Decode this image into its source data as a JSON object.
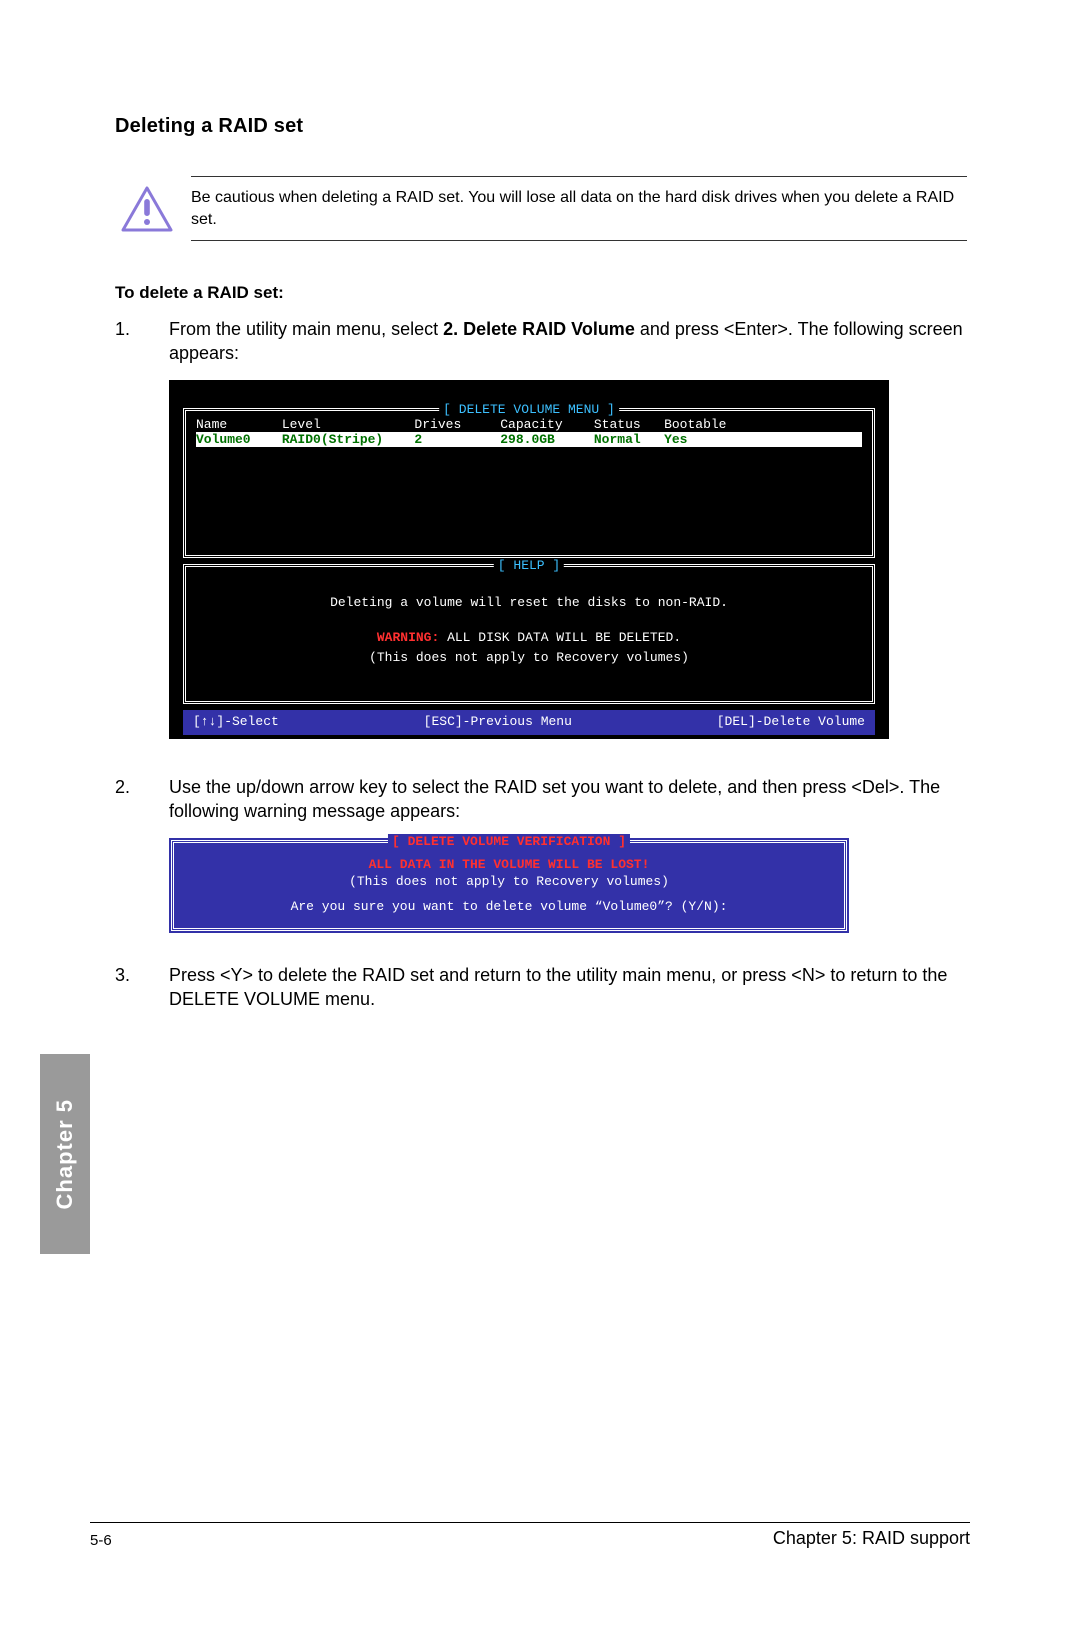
{
  "section_title": "Deleting a RAID set",
  "caution_text": "Be cautious when deleting a RAID set. You will lose all data on the hard disk drives when you delete a RAID set.",
  "subheading": "To delete a RAID set:",
  "step1": {
    "num": "1.",
    "prefix": "From the utility main menu, select ",
    "bold": "2. Delete RAID Volume",
    "suffix": " and press <Enter>. The following screen appears:"
  },
  "bios": {
    "title": "[ DELETE VOLUME MENU ]",
    "headers": "Name       Level            Drives     Capacity    Status   Bootable",
    "data": "Volume0    RAID0(Stripe)    2          298.0GB     Normal   Yes     ",
    "help_title": "[ HELP ]",
    "help_line1": "Deleting a volume will reset the disks to non-RAID.",
    "help_warning_label": "WARNING:",
    "help_warning_rest": " ALL DISK DATA WILL BE DELETED.",
    "help_note": "(This does not apply to Recovery volumes)",
    "footer_select": "[↑↓]-Select",
    "footer_prev": "[ESC]-Previous Menu",
    "footer_del": "[DEL]-Delete Volume"
  },
  "step2": {
    "num": "2.",
    "text": "Use the up/down arrow key to select the RAID set you want to delete, and then press <Del>. The following warning message appears:"
  },
  "verify": {
    "title": "[ DELETE VOLUME VERIFICATION ]",
    "red": "ALL DATA IN THE VOLUME WILL BE LOST!",
    "white": "(This does not apply to Recovery volumes)",
    "question": "Are you sure you want to delete volume “Volume0”? (Y/N):"
  },
  "step3": {
    "num": "3.",
    "text": "Press <Y> to delete the RAID set and return to the utility main menu, or press <N> to return to the DELETE VOLUME menu."
  },
  "tab_label": "Chapter 5",
  "page_num": "5-6",
  "footer_right": "Chapter 5: RAID support"
}
